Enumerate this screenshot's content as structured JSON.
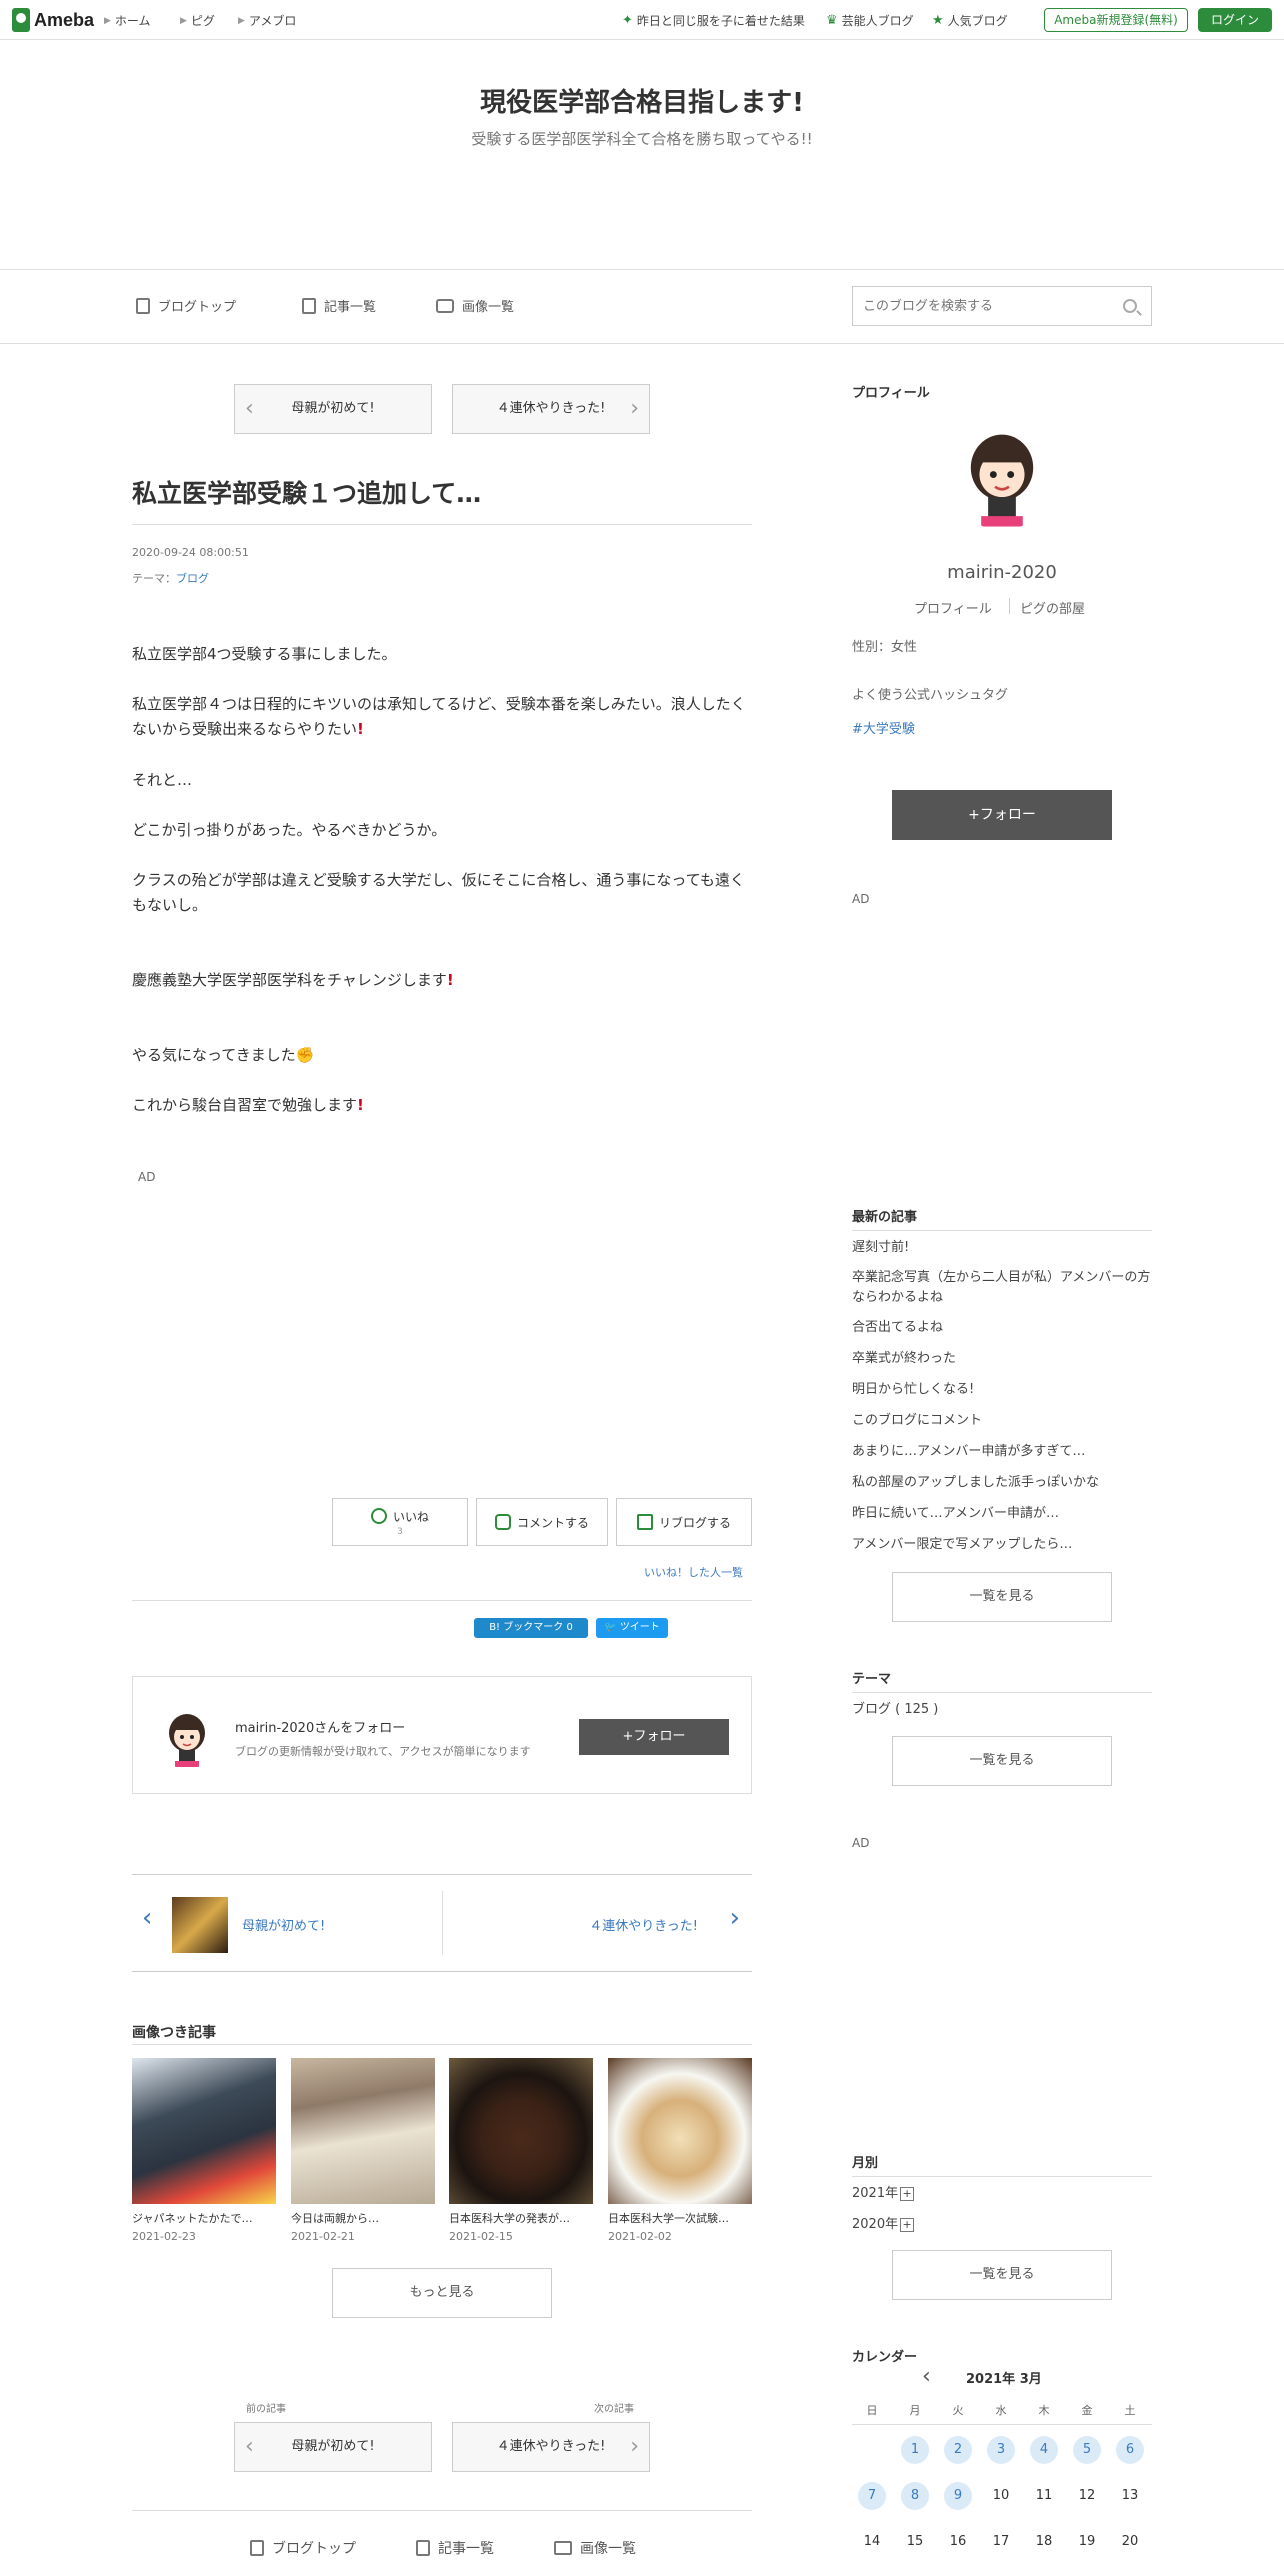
{
  "topbar": {
    "logo": "Ameba",
    "nav": [
      "ホーム",
      "ピグ",
      "アメブロ"
    ],
    "right_links": [
      "昨日と同じ服を子に着せた結果",
      "芸能人ブログ",
      "人気ブログ"
    ],
    "register": "Ameba新規登録(無料)",
    "login": "ログイン"
  },
  "header": {
    "title": "現役医学部合格目指します!",
    "description": "受験する医学部医学科全て合格を勝ち取ってやる!!"
  },
  "subnav": {
    "items": [
      "ブログトップ",
      "記事一覧",
      "画像一覧"
    ],
    "search_placeholder": "このブログを検索する"
  },
  "pager": {
    "prev": "母親が初めて!",
    "next": "４連休やりきった!"
  },
  "article": {
    "title": "私立医学部受験１つ追加して…",
    "date": "2020-09-24 08:00:51",
    "theme_label": "テーマ：",
    "theme": "ブログ",
    "paragraphs": [
      "私立医学部4つ受験する事にしました。",
      "私立医学部４つは日程的にキツいのは承知してるけど、受験本番を楽しみたい。浪人したくないから受験出来るならやりたい",
      "それと…",
      "どこか引っ掛りがあった。やるべきかどうか。",
      "クラスの殆どが学部は違えど受験する大学だし、仮にそこに合格し、通う事になっても遠くもないし。",
      "慶應義塾大学医学部医学科をチャレンジします",
      "やる気になってきました",
      "これから駿台自習室で勉強します"
    ],
    "ad": "AD"
  },
  "actions": {
    "like": "いいね",
    "like_count": "3",
    "comment": "コメントする",
    "reblog": "リブログする",
    "like_list": "いいね！した人一覧",
    "hatena": "B! ブックマーク",
    "hatena_count": "0",
    "tweet": "ツイート"
  },
  "follow_box": {
    "title": "mairin-2020さんをフォロー",
    "desc": "ブログの更新情報が受け取れて、アクセスが簡単になります",
    "button": "+フォロー"
  },
  "prev_next": {
    "prev": "母親が初めて!",
    "next": "４連休やりきった!"
  },
  "image_posts": {
    "heading": "画像つき記事",
    "items": [
      {
        "caption": "ジャパネットたかたで…",
        "date": "2021-02-23"
      },
      {
        "caption": "今日は両親から…",
        "date": "2021-02-21"
      },
      {
        "caption": "日本医科大学の発表が…",
        "date": "2021-02-15"
      },
      {
        "caption": "日本医科大学一次試験…",
        "date": "2021-02-02"
      }
    ],
    "more": "もっと見る"
  },
  "bottom_pager": {
    "prev_label": "前の記事",
    "next_label": "次の記事",
    "prev": "母親が初めて!",
    "next": "４連休やりきった!"
  },
  "footer_nav": [
    "ブログトップ",
    "記事一覧",
    "画像一覧"
  ],
  "sidebar": {
    "profile_heading": "プロフィール",
    "username": "mairin-2020",
    "profile_link": "プロフィール",
    "pig_link": "ピグの部屋",
    "gender": "性別：女性",
    "hashtag_heading": "よく使う公式ハッシュタグ",
    "hashtag": "#大学受験",
    "follow": "+フォロー",
    "ad": "AD",
    "latest_heading": "最新の記事",
    "latest": [
      "遅刻寸前!",
      "卒業記念写真（左から二人目が私）アメンバーの方ならわかるよね",
      "合否出てるよね",
      "卒業式が終わった",
      "明日から忙しくなる!",
      "このブログにコメント",
      "あまりに…アメンバー申請が多すぎて…",
      "私の部屋のアップしました派手っぽいかな",
      "昨日に続いて…アメンバー申請が…",
      "アメンバー限定で写メアップしたら…"
    ],
    "list_button": "一覧を見る",
    "theme_heading": "テーマ",
    "theme_item": "ブログ ( 125 )",
    "ad2": "AD",
    "monthly_heading": "月別",
    "months": [
      "2021年",
      "2020年"
    ],
    "calendar_heading": "カレンダー",
    "calendar_month": "2021年 3月",
    "weekdays": [
      "日",
      "月",
      "火",
      "水",
      "木",
      "金",
      "土"
    ],
    "week1": [
      "1",
      "2",
      "3",
      "4",
      "5",
      "6"
    ],
    "week2": [
      "7",
      "8",
      "9",
      "10",
      "11",
      "12",
      "13"
    ],
    "week3": [
      "14",
      "15",
      "16",
      "17",
      "18",
      "19",
      "20"
    ]
  },
  "colors": {
    "brand_green": "#2d8c3c",
    "link_blue": "#3b7ac0",
    "dark_button": "#555555"
  }
}
